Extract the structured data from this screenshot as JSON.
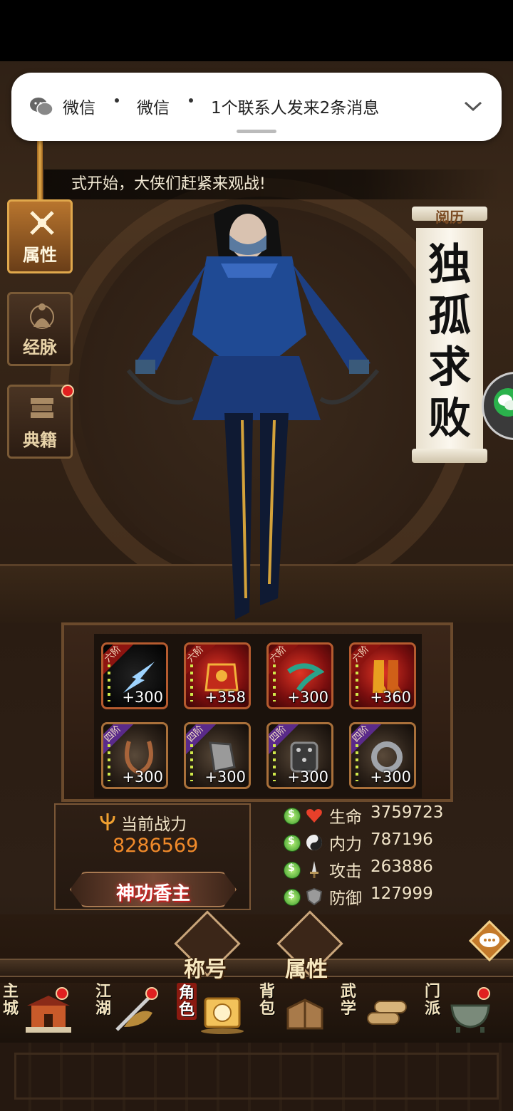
{
  "notification": {
    "app": "微信",
    "source": "微信",
    "message": "1个联系人发来2条消息"
  },
  "marquee": {
    "text": "式开始，大侠们赶紧来观战!"
  },
  "side_tabs": [
    {
      "label": "属性",
      "active": true,
      "badge": false
    },
    {
      "label": "经脉",
      "active": false,
      "badge": false
    },
    {
      "label": "典籍",
      "active": false,
      "badge": true
    }
  ],
  "title_scroll": {
    "header": "阅历",
    "title_chars": [
      "独",
      "孤",
      "求",
      "败"
    ]
  },
  "equipment": [
    {
      "tier": "六阶",
      "level": "+300",
      "item_icon": "lightning-sword-icon"
    },
    {
      "tier": "六阶",
      "level": "+358",
      "item_icon": "red-armor-icon"
    },
    {
      "tier": "六阶",
      "level": "+300",
      "item_icon": "jade-dragon-belt-icon"
    },
    {
      "tier": "六阶",
      "level": "+360",
      "item_icon": "flame-boots-icon"
    },
    {
      "tier": "四阶",
      "level": "+300",
      "item_icon": "horn-talisman-icon"
    },
    {
      "tier": "四阶",
      "level": "+300",
      "item_icon": "iron-gauntlet-icon"
    },
    {
      "tier": "四阶",
      "level": "+300",
      "item_icon": "studded-bracer-icon"
    },
    {
      "tier": "四阶",
      "level": "+300",
      "item_icon": "iron-ring-icon"
    }
  ],
  "power": {
    "label": "当前战力",
    "value": "8286569",
    "button": "神功香主"
  },
  "stats": [
    {
      "name": "生命",
      "value": "3759723",
      "icon": "heart-icon"
    },
    {
      "name": "内力",
      "value": "787196",
      "icon": "yin-yang-icon"
    },
    {
      "name": "攻击",
      "value": "263886",
      "icon": "sword-icon"
    },
    {
      "name": "防御",
      "value": "127999",
      "icon": "shield-icon"
    }
  ],
  "sub_tabs": [
    {
      "label": "称号"
    },
    {
      "label": "属性"
    }
  ],
  "nav": [
    {
      "label": "主城",
      "badge": true,
      "active": false
    },
    {
      "label": "江湖",
      "badge": true,
      "active": false
    },
    {
      "label": "角色",
      "badge": false,
      "active": true
    },
    {
      "label": "背包",
      "badge": false,
      "active": false
    },
    {
      "label": "武学",
      "badge": false,
      "active": false
    },
    {
      "label": "门派",
      "badge": true,
      "active": false
    }
  ],
  "colors": {
    "power_value": "#f08a2a",
    "badge_red": "#e02020",
    "accent_gold": "#e0a84c"
  }
}
